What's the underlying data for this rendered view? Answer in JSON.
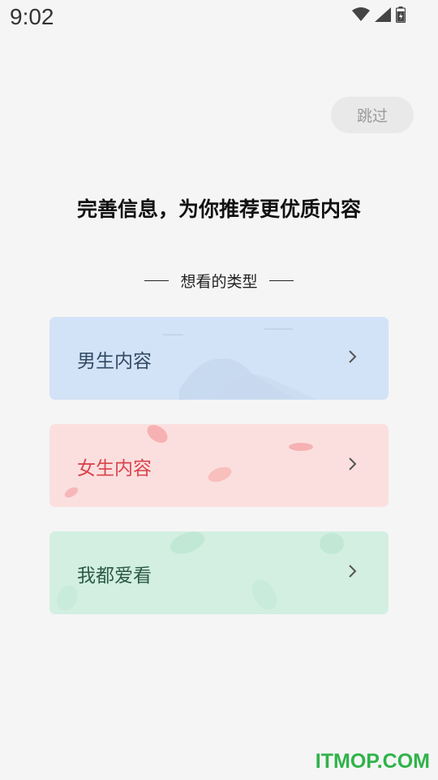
{
  "status_bar": {
    "time": "9:02",
    "icons": [
      "wifi-icon",
      "signal-icon",
      "battery-icon"
    ]
  },
  "skip_label": "跳过",
  "headline": "完善信息，为你推荐更优质内容",
  "section_title": "想看的类型",
  "options": [
    {
      "label": "男生内容",
      "color": "#324a64",
      "bg": "#d3e3f7"
    },
    {
      "label": "女生内容",
      "color": "#d9444c",
      "bg": "#fbdfdf"
    },
    {
      "label": "我都爱看",
      "color": "#2d5a48",
      "bg": "#d2efe2"
    }
  ],
  "watermark": "ITMOP.COM"
}
